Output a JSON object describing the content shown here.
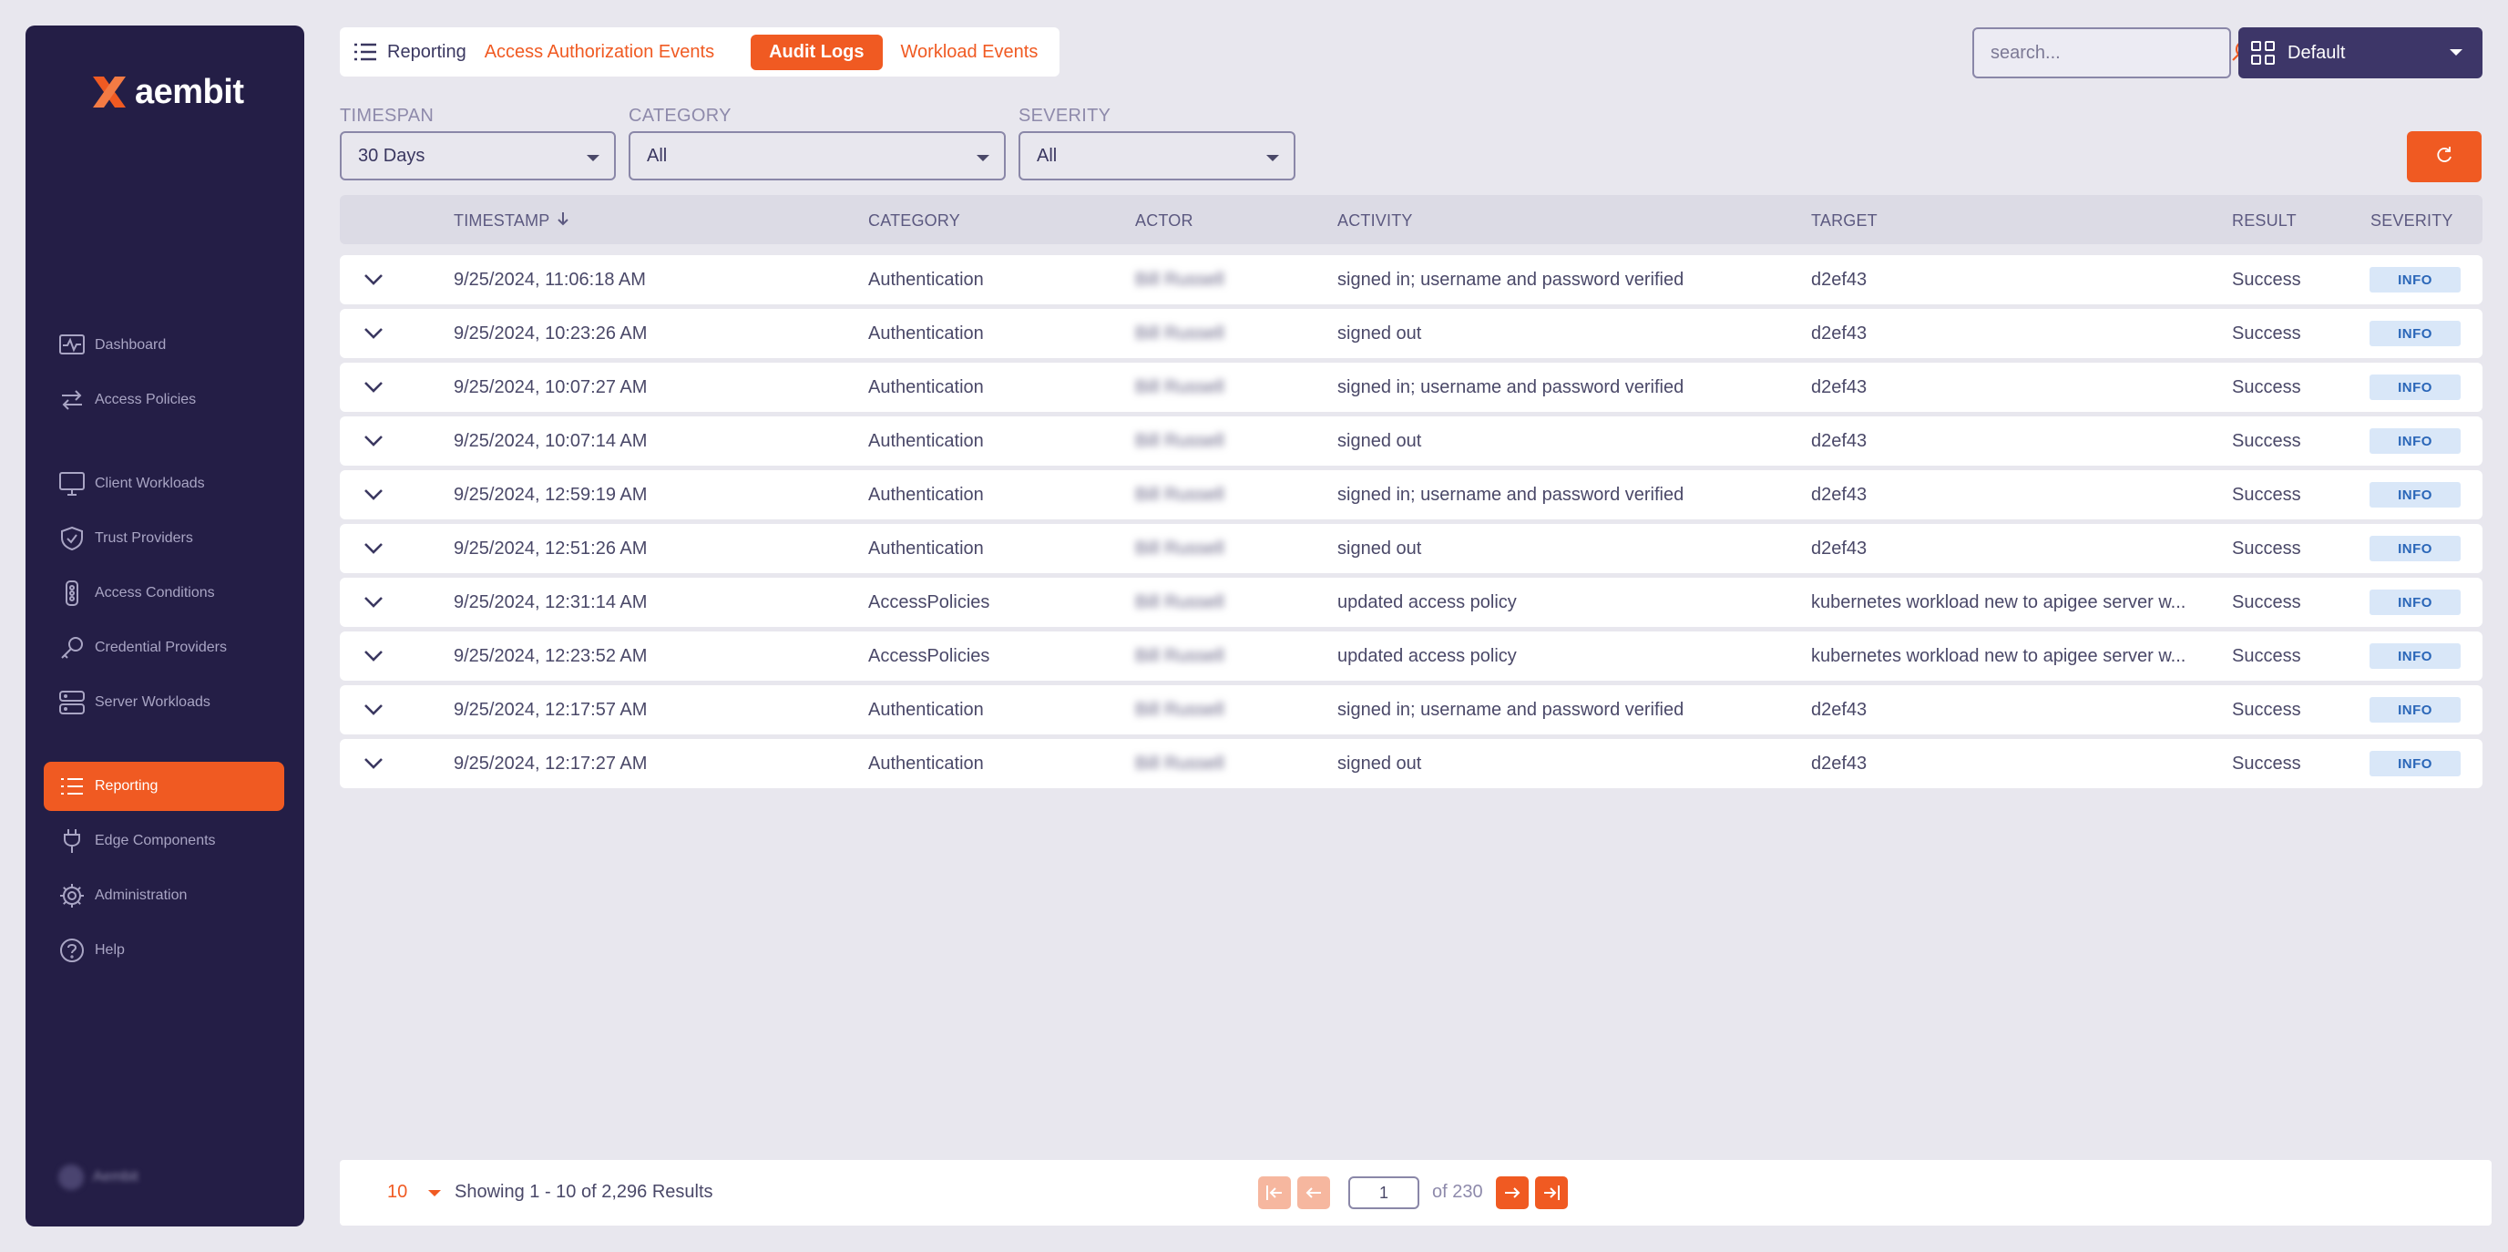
{
  "app": {
    "logo_text": "aembit",
    "brand_color": "#f05a22",
    "sidebar_color": "#241e46"
  },
  "sidebar": {
    "items": [
      {
        "label": "Dashboard",
        "icon": "activity-monitor-icon"
      },
      {
        "label": "Access Policies",
        "icon": "arrows-exchange-icon"
      },
      {
        "label": "Client Workloads",
        "icon": "monitor-icon"
      },
      {
        "label": "Trust Providers",
        "icon": "shield-check-icon"
      },
      {
        "label": "Access Conditions",
        "icon": "traffic-light-icon"
      },
      {
        "label": "Credential Providers",
        "icon": "key-icon"
      },
      {
        "label": "Server Workloads",
        "icon": "server-icon"
      },
      {
        "label": "Reporting",
        "icon": "list-icon",
        "active": true
      },
      {
        "label": "Edge Components",
        "icon": "plug-icon"
      },
      {
        "label": "Administration",
        "icon": "gear-icon"
      },
      {
        "label": "Help",
        "icon": "help-circle-icon"
      }
    ],
    "user_name": "Aembit"
  },
  "header": {
    "title": "Reporting",
    "tabs": [
      {
        "label": "Access Authorization Events"
      },
      {
        "label": "Audit Logs",
        "active": true
      },
      {
        "label": "Workload Events"
      }
    ],
    "search_placeholder": "search...",
    "view_selector": "Default"
  },
  "filters": {
    "timespan": {
      "label": "TIMESPAN",
      "value": "30 Days"
    },
    "category": {
      "label": "CATEGORY",
      "value": "All"
    },
    "severity": {
      "label": "SEVERITY",
      "value": "All"
    }
  },
  "table": {
    "columns": [
      "TIMESTAMP",
      "CATEGORY",
      "ACTOR",
      "ACTIVITY",
      "TARGET",
      "RESULT",
      "SEVERITY"
    ],
    "rows": [
      {
        "timestamp": "9/25/2024, 11:06:18 AM",
        "category": "Authentication",
        "actor": "Bill Russell",
        "activity": "signed in; username and password verified",
        "target": "d2ef43",
        "result": "Success",
        "severity": "INFO"
      },
      {
        "timestamp": "9/25/2024, 10:23:26 AM",
        "category": "Authentication",
        "actor": "Bill Russell",
        "activity": "signed out",
        "target": "d2ef43",
        "result": "Success",
        "severity": "INFO"
      },
      {
        "timestamp": "9/25/2024, 10:07:27 AM",
        "category": "Authentication",
        "actor": "Bill Russell",
        "activity": "signed in; username and password verified",
        "target": "d2ef43",
        "result": "Success",
        "severity": "INFO"
      },
      {
        "timestamp": "9/25/2024, 10:07:14 AM",
        "category": "Authentication",
        "actor": "Bill Russell",
        "activity": "signed out",
        "target": "d2ef43",
        "result": "Success",
        "severity": "INFO"
      },
      {
        "timestamp": "9/25/2024, 12:59:19 AM",
        "category": "Authentication",
        "actor": "Bill Russell",
        "activity": "signed in; username and password verified",
        "target": "d2ef43",
        "result": "Success",
        "severity": "INFO"
      },
      {
        "timestamp": "9/25/2024, 12:51:26 AM",
        "category": "Authentication",
        "actor": "Bill Russell",
        "activity": "signed out",
        "target": "d2ef43",
        "result": "Success",
        "severity": "INFO"
      },
      {
        "timestamp": "9/25/2024, 12:31:14 AM",
        "category": "AccessPolicies",
        "actor": "Bill Russell",
        "activity": "updated access policy",
        "target": "kubernetes workload new to apigee server w...",
        "result": "Success",
        "severity": "INFO"
      },
      {
        "timestamp": "9/25/2024, 12:23:52 AM",
        "category": "AccessPolicies",
        "actor": "Bill Russell",
        "activity": "updated access policy",
        "target": "kubernetes workload new to apigee server w...",
        "result": "Success",
        "severity": "INFO"
      },
      {
        "timestamp": "9/25/2024, 12:17:57 AM",
        "category": "Authentication",
        "actor": "Bill Russell",
        "activity": "signed in; username and password verified",
        "target": "d2ef43",
        "result": "Success",
        "severity": "INFO"
      },
      {
        "timestamp": "9/25/2024, 12:17:27 AM",
        "category": "Authentication",
        "actor": "Bill Russell",
        "activity": "signed out",
        "target": "d2ef43",
        "result": "Success",
        "severity": "INFO"
      }
    ]
  },
  "pagination": {
    "page_size": "10",
    "showing": "Showing 1 - 10 of 2,296 Results",
    "current_page": "1",
    "of_total": "of 230"
  }
}
